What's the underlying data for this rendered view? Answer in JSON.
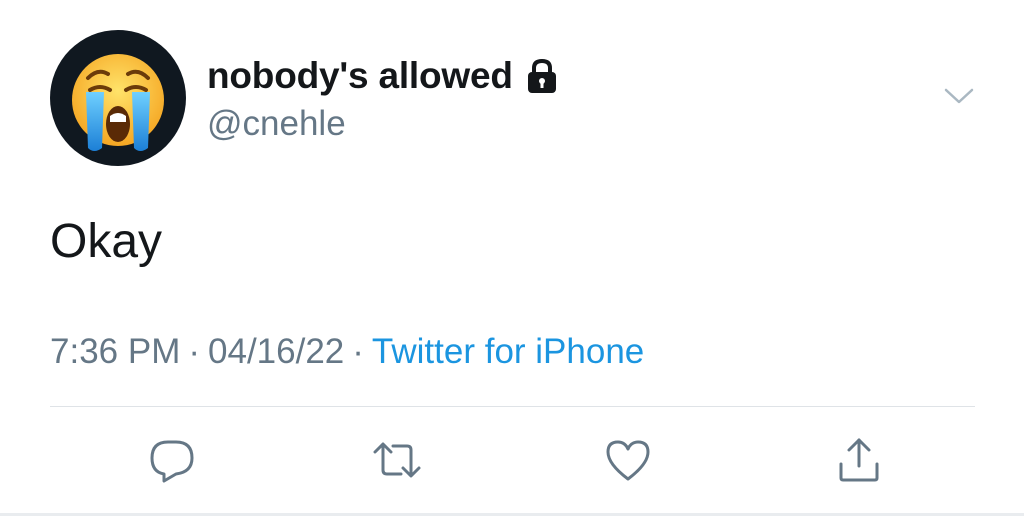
{
  "user": {
    "display_name": "nobody's allowed",
    "handle": "@cnehle",
    "avatar_icon": "crying-face-emoji",
    "protected_icon": "lock-icon"
  },
  "tweet": {
    "text": "Okay",
    "time": "7:36 PM",
    "separator": "·",
    "date": "04/16/22",
    "source": "Twitter for iPhone"
  },
  "actions": {
    "reply_icon": "reply-icon",
    "retweet_icon": "retweet-icon",
    "like_icon": "heart-icon",
    "share_icon": "share-icon"
  },
  "colors": {
    "text_primary": "#14171a",
    "text_secondary": "#657786",
    "link": "#1b95e0",
    "icon": "#657786",
    "divider": "#dfe3e7"
  }
}
